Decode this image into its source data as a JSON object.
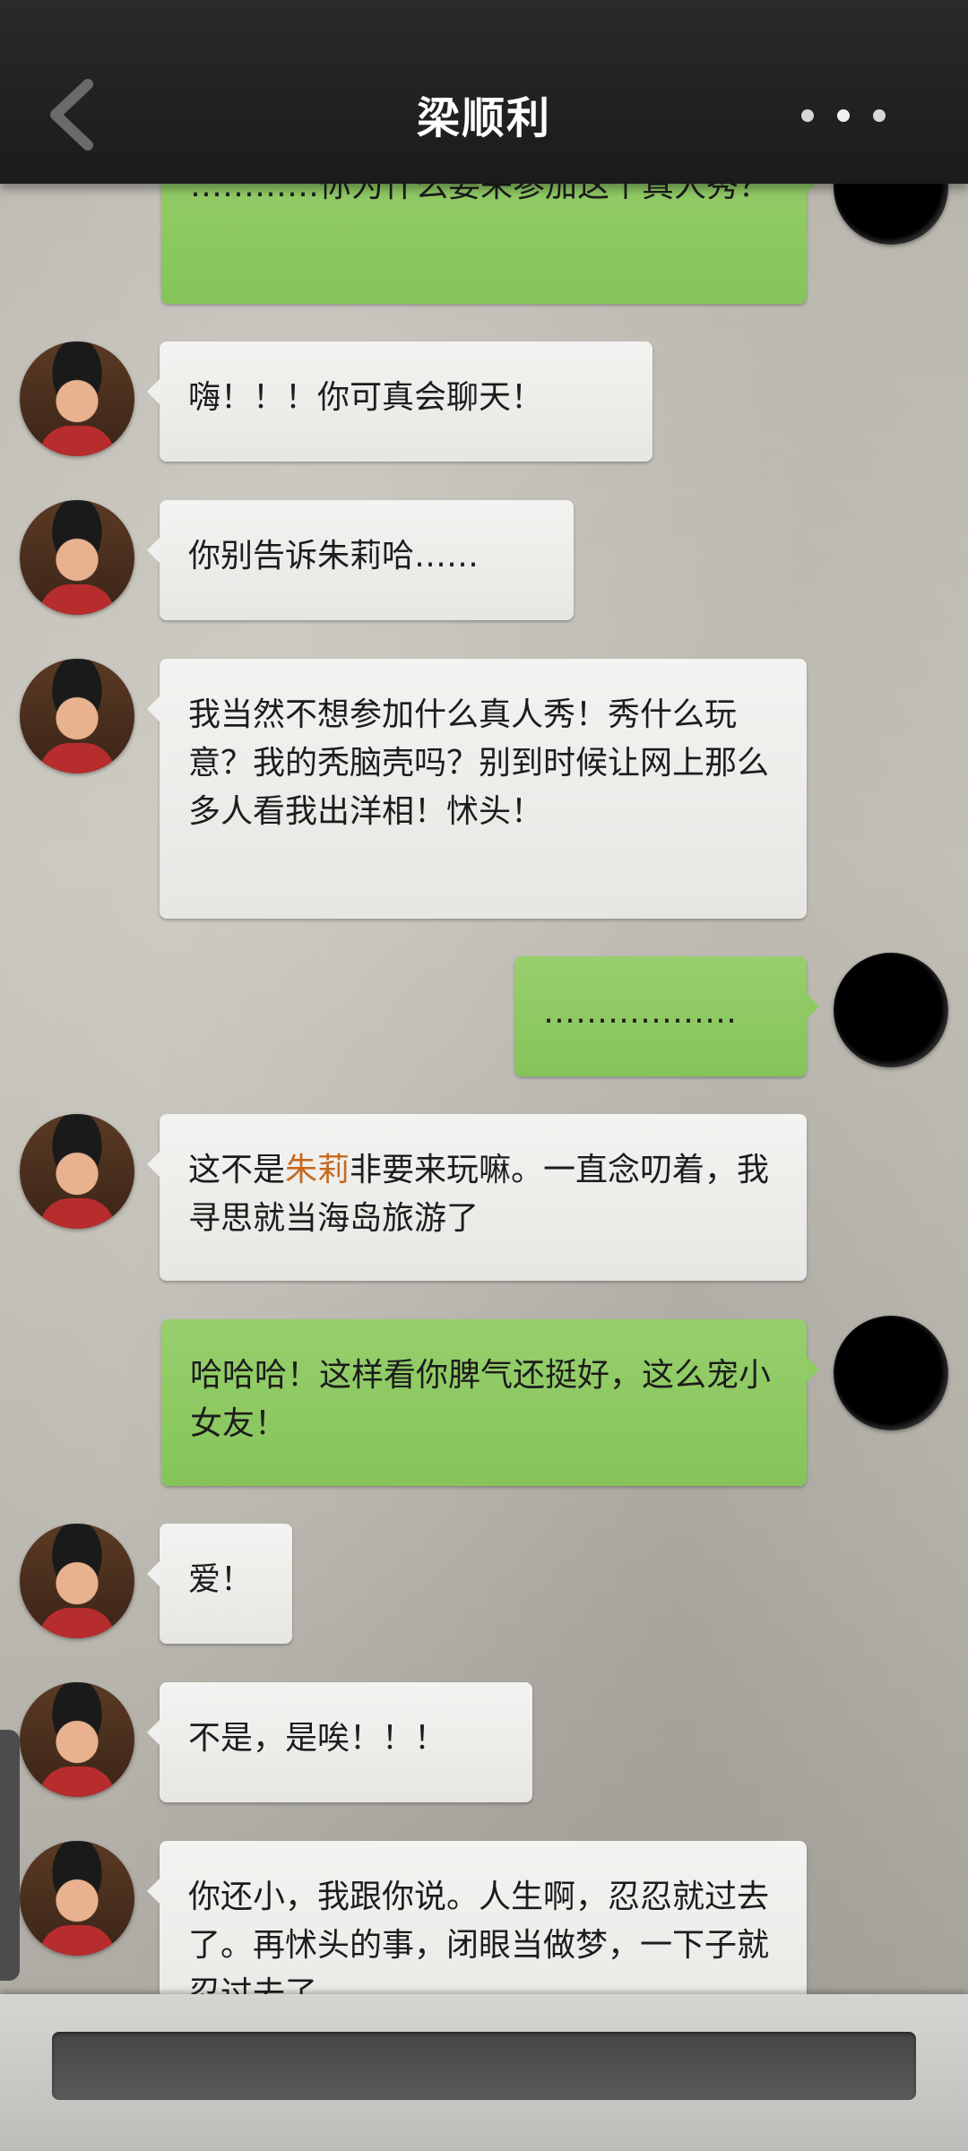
{
  "header": {
    "title": "梁顺利",
    "back_icon": "chevron-left-icon",
    "more_icon": "more-dots-icon"
  },
  "messages": [
    {
      "sender": "me",
      "text": "…………你为什么要来参加这个真人秀？"
    },
    {
      "sender": "other",
      "text": "嗨！！！你可真会聊天！"
    },
    {
      "sender": "other",
      "text": "你别告诉朱莉哈……"
    },
    {
      "sender": "other",
      "text": "我当然不想参加什么真人秀！秀什么玩意？我的秃脑壳吗？别到时候让网上那么多人看我出洋相！怵头！"
    },
    {
      "sender": "me",
      "text": "………………"
    },
    {
      "sender": "other",
      "text_before": "这不是",
      "highlight": "朱莉",
      "text_after": "非要来玩嘛。一直念叨着，我寻思就当海岛旅游了"
    },
    {
      "sender": "me",
      "text": "哈哈哈！这样看你脾气还挺好，这么宠小女友！"
    },
    {
      "sender": "other",
      "text": "爱！"
    },
    {
      "sender": "other",
      "text": "不是，是唉！！！"
    },
    {
      "sender": "other",
      "text": "你还小，我跟你说。人生啊，忍忍就过去了。再怵头的事，闭眼当做梦，一下子就忍过去了。"
    }
  ],
  "colors": {
    "header_bg": "#1f1f1f",
    "my_bubble": "#8fca62",
    "other_bubble": "#efefed",
    "highlight": "#c56a1e"
  },
  "input": {
    "placeholder": ""
  }
}
